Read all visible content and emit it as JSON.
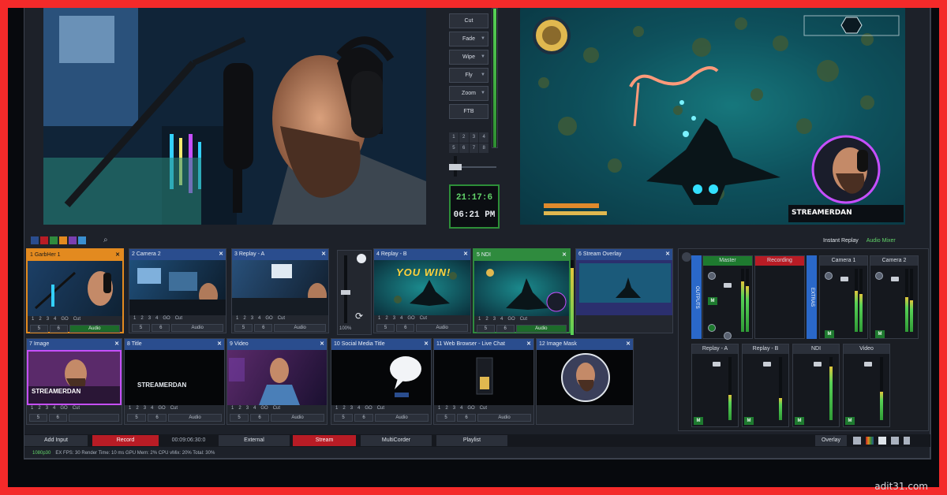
{
  "transitions": {
    "buttons": [
      "Cut",
      "Fade",
      "Wipe",
      "Fly",
      "Zoom",
      "FTB"
    ],
    "numbers": [
      "1",
      "2",
      "3",
      "4",
      "5",
      "6",
      "7",
      "8"
    ]
  },
  "clock": {
    "time1": "21:17:6",
    "time2": "06:21 PM"
  },
  "program_overlay": {
    "brand": "STREAMERDAN"
  },
  "mixer_header": {
    "instant_replay": "Instant Replay",
    "audio_mixer": "Audio Mixer"
  },
  "card_controls": {
    "nums": [
      "1",
      "2",
      "3",
      "4"
    ],
    "go": "GO",
    "cut": "Cut",
    "audio": "Audio",
    "nums2": [
      "5",
      "6",
      "7",
      "8"
    ]
  },
  "inputs_top": [
    {
      "num": "1",
      "name": "GarbHer 1",
      "style": "orange"
    },
    {
      "num": "2",
      "name": "Camera 2",
      "style": "blue"
    },
    {
      "num": "3",
      "name": "Replay - A",
      "style": "blue"
    },
    {
      "num": "4",
      "name": "Replay - B",
      "style": "blue",
      "overlay": "YOU WIN!"
    },
    {
      "num": "5",
      "name": "NDI",
      "style": "green"
    },
    {
      "num": "6",
      "name": "Stream Overlay",
      "style": "blue"
    }
  ],
  "inputs_bottom": [
    {
      "num": "7",
      "name": "Image",
      "brand": "STREAMERDAN"
    },
    {
      "num": "8",
      "name": "Title",
      "brand": "STREAMERDAN"
    },
    {
      "num": "9",
      "name": "Video"
    },
    {
      "num": "10",
      "name": "Social Media Title"
    },
    {
      "num": "11",
      "name": "Web Browser - Live Chat"
    },
    {
      "num": "12",
      "name": "Image Mask"
    }
  ],
  "zoom_readout": "100%",
  "audio": {
    "outputs_label": "OUTPUTS",
    "master": "Master",
    "recording": "Recording",
    "extras_label": "EXTRAS",
    "top_channels": [
      "Camera 1",
      "Camera 2"
    ],
    "bottom_channels": [
      "Replay - A",
      "Replay - B",
      "NDI",
      "Video"
    ],
    "mute_label": "M"
  },
  "bottom_bar": {
    "add_input": "Add Input",
    "record": "Record",
    "record_time": "00:09:06:30:0",
    "external": "External",
    "stream": "Stream",
    "multicorder": "MultiCorder",
    "playlist": "Playlist",
    "overlay": "Overlay"
  },
  "status_bar": {
    "resolution": "1080p30",
    "text": "EX  FPS:  30  Render Time:  10 ms  GPU Mem:  2%  CPU vMix:  20%  Total:  30%"
  },
  "watermark": "adit31.com"
}
